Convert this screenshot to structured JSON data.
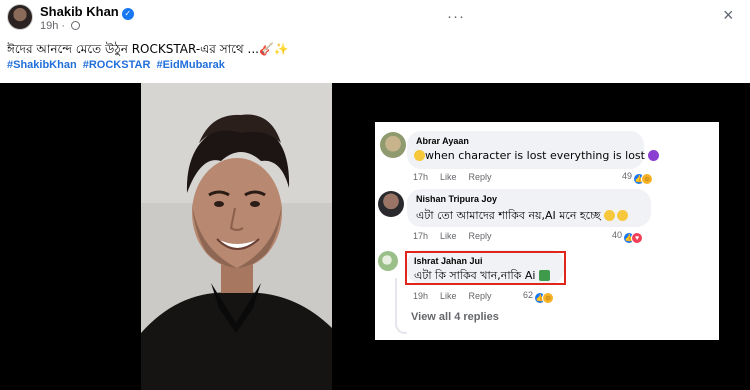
{
  "post": {
    "author": "Shakib Khan",
    "time": "19h",
    "text": "ঈদের আনন্দে মেতে উঠুন ROCKSTAR-এর সাথে ...",
    "text_emoji": "🎸✨",
    "hashtags": [
      "#ShakibKhan",
      "#ROCKSTAR",
      "#EidMubarak"
    ],
    "more_label": "···",
    "close_label": "×"
  },
  "comments": [
    {
      "name": "Abrar Ayaan",
      "text": "when character is lost everything is lost",
      "time": "17h",
      "like": "Like",
      "reply": "Reply",
      "count": "49"
    },
    {
      "name": "Nishan Tripura Joy",
      "text": "এটা তো আমাদের শাকিব নয়,AI মনে হচ্ছে",
      "time": "17h",
      "like": "Like",
      "reply": "Reply",
      "count": "40"
    },
    {
      "name": "Ishrat Jahan Jui",
      "text": "এটা কি সাকিব খান,নাকি Ai",
      "time": "19h",
      "like": "Like",
      "reply": "Reply",
      "count": "62"
    }
  ],
  "view_replies": "View all 4 replies",
  "colors": {
    "link": "#216fdb",
    "highlight": "#e0251b",
    "bubble": "#f0f2f5"
  }
}
